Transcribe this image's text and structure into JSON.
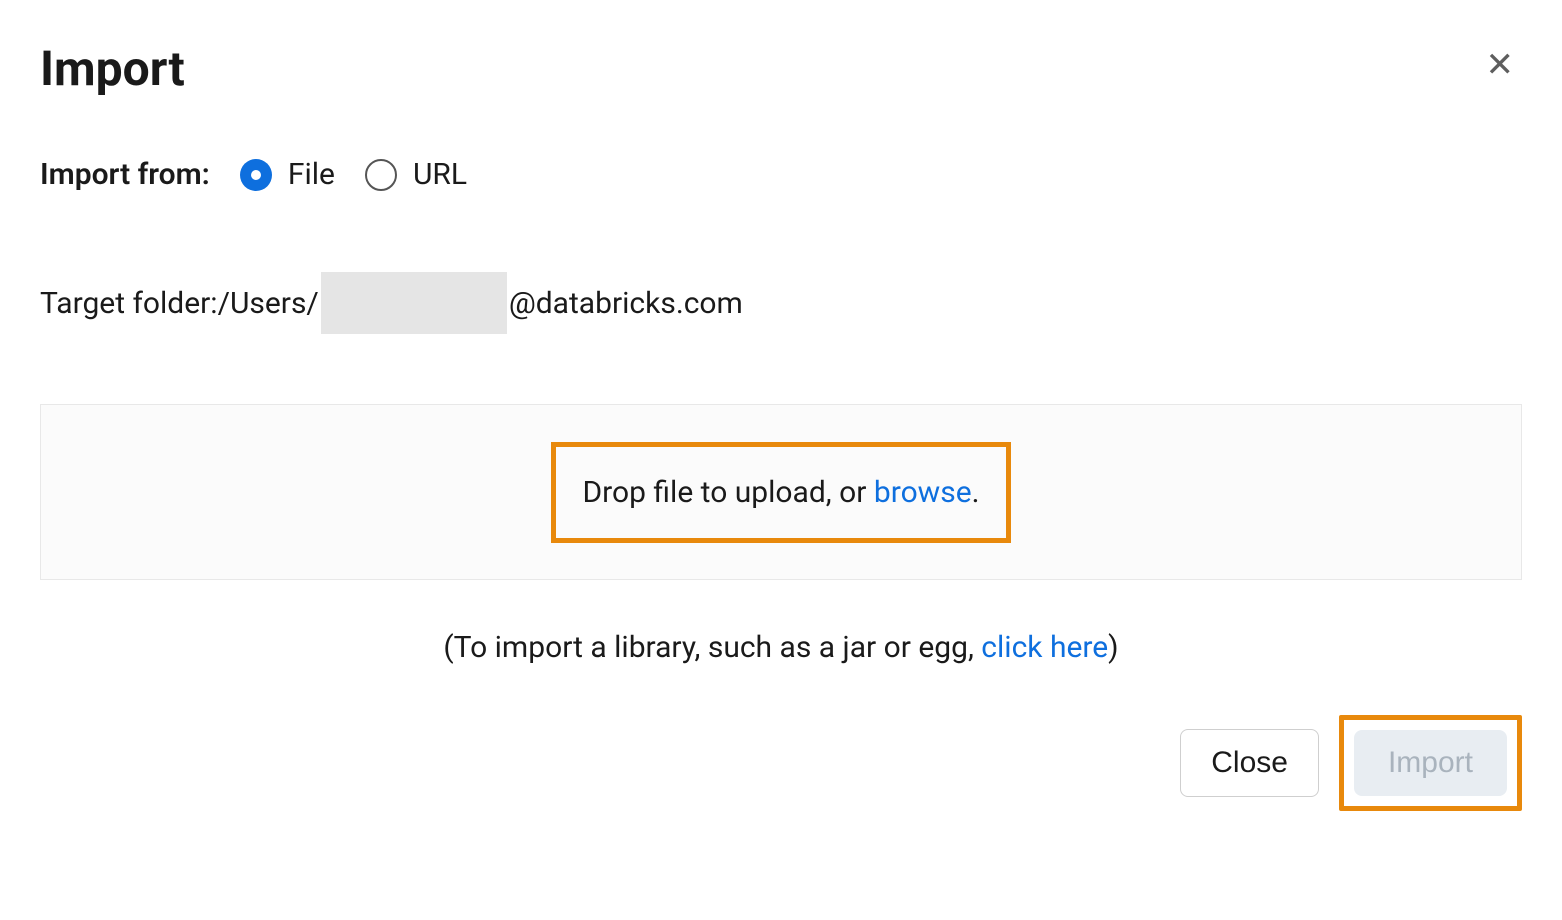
{
  "header": {
    "title": "Import"
  },
  "importFrom": {
    "label": "Import from:",
    "options": {
      "file": "File",
      "url": "URL"
    },
    "selected": "file"
  },
  "targetFolder": {
    "label": "Target folder: ",
    "prefix": "/Users/",
    "suffix": "@databricks.com"
  },
  "dropzone": {
    "text": "Drop file to upload, or ",
    "link": "browse",
    "after": "."
  },
  "libraryHint": {
    "before": "(To import a library, such as a jar or egg, ",
    "link": "click here",
    "after": ")"
  },
  "footer": {
    "close": "Close",
    "import": "Import"
  }
}
